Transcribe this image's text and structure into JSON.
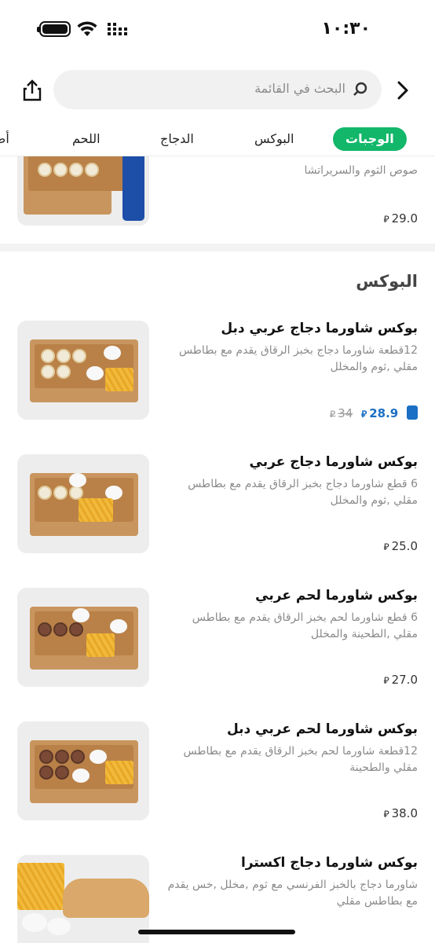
{
  "status_bar": {
    "time": "١٠:٣٠"
  },
  "search": {
    "placeholder": "البحث في القائمة"
  },
  "tabs": [
    {
      "label": "الوجبات",
      "active": true
    },
    {
      "label": "البوكس",
      "active": false
    },
    {
      "label": "الدجاج",
      "active": false
    },
    {
      "label": "اللحم",
      "active": false
    },
    {
      "label": "أص",
      "active": false
    }
  ],
  "partial_item": {
    "desc": "صوص الثوم والسريراتشا",
    "price": "29.0"
  },
  "section": {
    "title": "البوكس"
  },
  "currency": "⃁",
  "items": [
    {
      "name": "بوكس شاورما دجاج عربي دبل",
      "desc": "12قطعة شاورما دجاج بخبز الرقاق يقدم مع بطاطس مقلي ,ثوم والمخلل",
      "price": "28.9",
      "old_price": "34",
      "discounted": true
    },
    {
      "name": "بوكس شاورما دجاج عربي",
      "desc": "6 قطع شاورما دجاج بخبز الرقاق يقدم مع بطاطس مقلي ,ثوم والمخلل",
      "price": "25.0"
    },
    {
      "name": "بوكس شاورما لحم عربي",
      "desc": "6 قطع شاورما لحم بخبز الرقاق يقدم مع بطاطس مقلي ,الطحينة والمخلل",
      "price": "27.0"
    },
    {
      "name": "بوكس شاورما لحم عربي دبل",
      "desc": "12قطعة شاورما لحم بخبز الرقاق يقدم مع بطاطس مقلي والطحينة",
      "price": "38.0"
    },
    {
      "name": "بوكس شاورما دجاج اكسترا",
      "desc": "شاورما دجاج بالخبز الفرنسي مع ثوم ,مخلل ,خس يقدم مع بطاطس مقلي",
      "price": ""
    }
  ],
  "colors": {
    "accent": "#12b76a",
    "discount": "#1b6fc4"
  }
}
